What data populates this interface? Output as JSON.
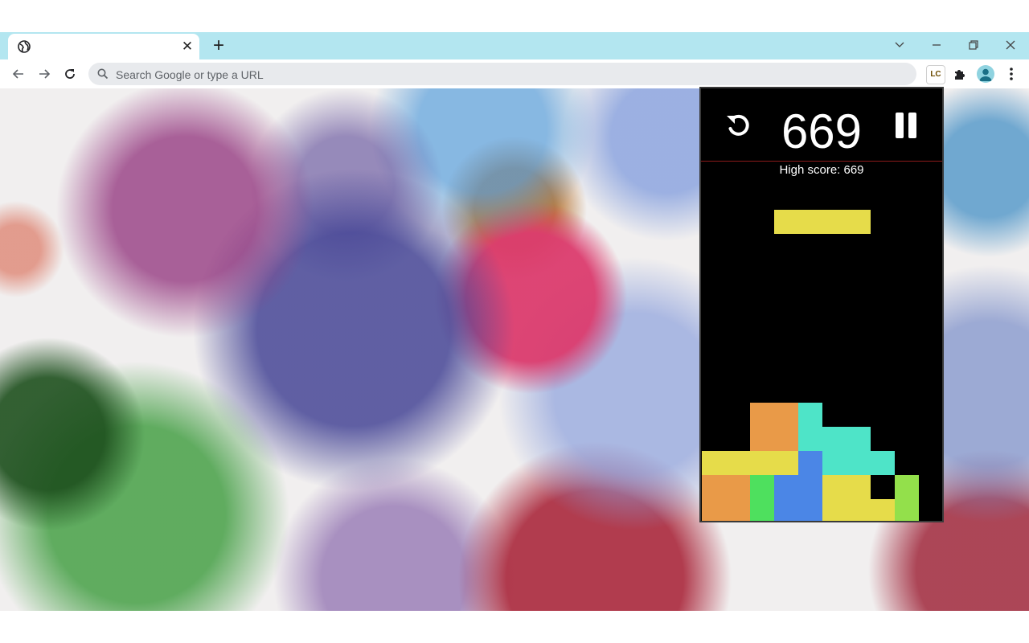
{
  "browser": {
    "tab": {
      "favicon_icon": "globe-icon",
      "close_icon": "close-icon"
    },
    "new_tab_icon": "plus-icon",
    "window_controls": [
      "chevron-down-icon",
      "minimize-icon",
      "restore-icon",
      "close-icon"
    ],
    "omnibox": {
      "placeholder": "Search Google or type a URL",
      "value": ""
    },
    "extensions": {
      "lc_label": "LC",
      "puzzle_icon": "puzzle-icon"
    },
    "profile_icon": "avatar-icon",
    "menu_icon": "more-vert-icon"
  },
  "game": {
    "score": "669",
    "high_score_text": "High score: 669",
    "restart_icon": "restart-icon",
    "pause_icon": "pause-icon",
    "colors": {
      "yellow": "#e6dc4a",
      "orange": "#e99a48",
      "cyan": "#4ee4c8",
      "blue": "#4b86e6",
      "green": "#4ee05e",
      "lime": "#93e04b",
      "background": "#000000"
    },
    "falling_piece": {
      "shape": "I",
      "orientation": "horizontal",
      "color": "yellow"
    },
    "stack_colors": [
      "orange",
      "cyan",
      "yellow",
      "blue",
      "green",
      "lime"
    ]
  }
}
